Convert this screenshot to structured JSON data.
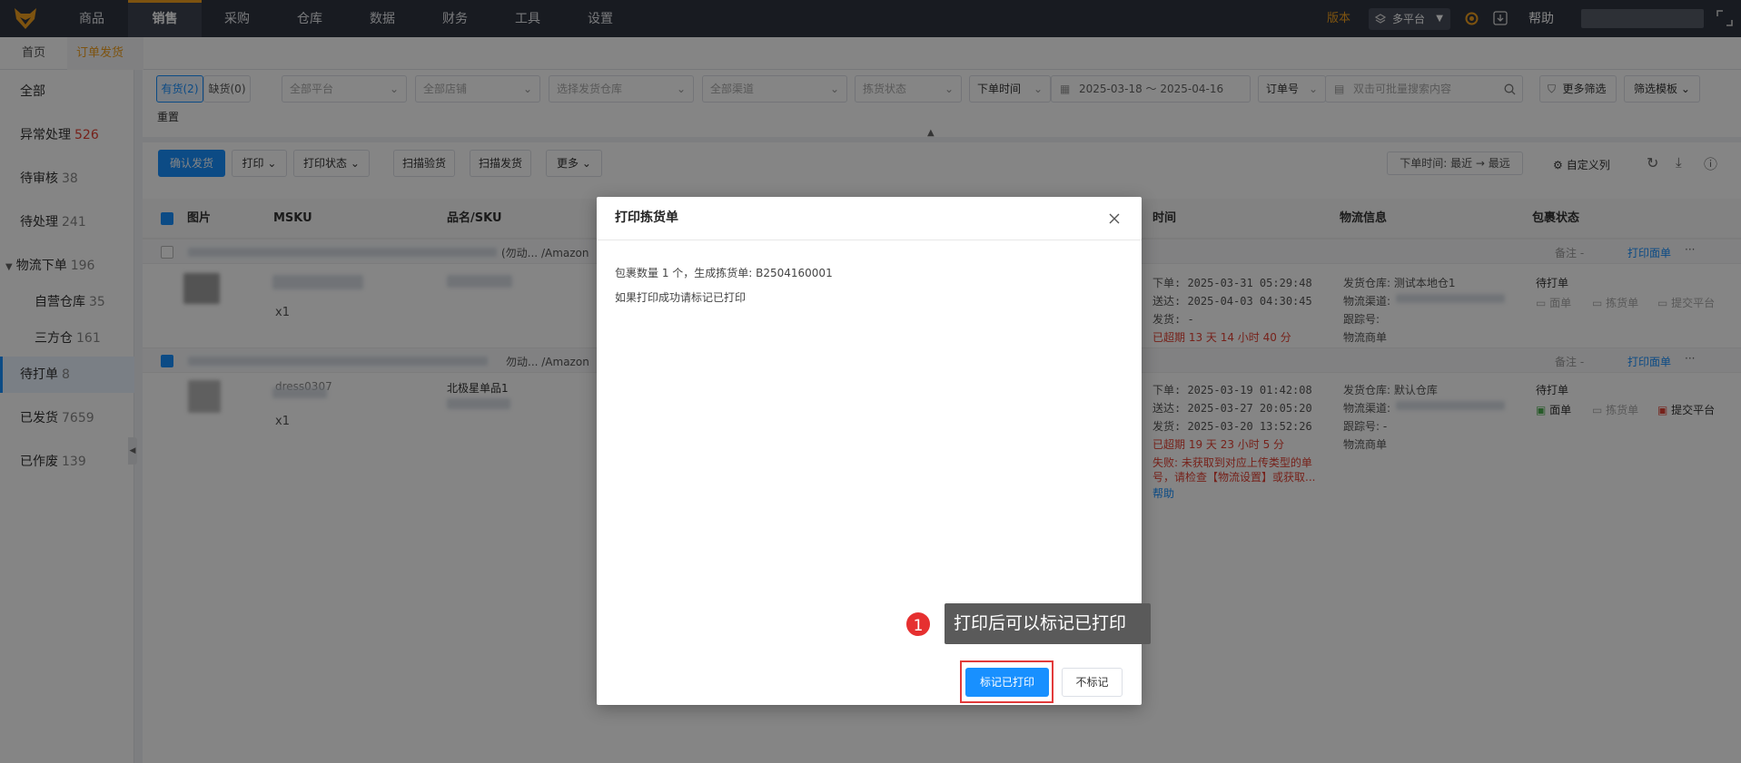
{
  "topnav": {
    "items": [
      "商品",
      "销售",
      "采购",
      "仓库",
      "数据",
      "财务",
      "工具",
      "设置"
    ],
    "active_index": 1,
    "version": "版本",
    "platform": "多平台",
    "help": "帮助"
  },
  "tabs": [
    "首页",
    "订单发货"
  ],
  "sidebar": [
    {
      "label": "全部",
      "count": ""
    },
    {
      "label": "异常处理",
      "count": "526"
    },
    {
      "label": "待审核",
      "count": "38"
    },
    {
      "label": "待处理",
      "count": "241"
    },
    {
      "label": "物流下单",
      "count": "196"
    },
    {
      "label": "自营仓库",
      "count": "35"
    },
    {
      "label": "三方仓",
      "count": "161"
    },
    {
      "label": "待打单",
      "count": "8"
    },
    {
      "label": "已发货",
      "count": "7659"
    },
    {
      "label": "已作废",
      "count": "139"
    }
  ],
  "filters": {
    "stock_yes": "有货(2)",
    "stock_no": "缺货(0)",
    "platform": "全部平台",
    "store": "全部店铺",
    "warehouse": "选择发货仓库",
    "channel": "全部渠道",
    "pick_status": "拣货状态",
    "time_type": "下单时间",
    "date_range": "2025-03-18 ～ 2025-04-16",
    "order_no": "订单号",
    "search_placeholder": "双击可批量搜索内容",
    "more_filter": "更多筛选",
    "template": "筛选模板",
    "reset": "重置"
  },
  "toolbar": {
    "confirm": "确认发货",
    "print": "打印",
    "print_status": "打印状态",
    "scan_check": "扫描验货",
    "scan_ship": "扫描发货",
    "more": "更多",
    "sort_label": "下单时间:",
    "sort_value": "最近 → 最远",
    "custom_cols": "自定义列"
  },
  "table": {
    "headers": [
      "图片",
      "MSKU",
      "品名/SKU",
      "时间",
      "物流信息",
      "包裹状态"
    ],
    "rows": [
      {
        "head_suffix": "(勿动... /Amazon",
        "remark": "备注 -",
        "print_label": "打印面单",
        "qty": "x1",
        "time_order": "下单: 2025-03-31 05:29:48",
        "time_deliver": "送达: 2025-04-03 04:30:45",
        "time_ship": "发货: -",
        "overdue": "已超期 13 天 14 小时 40 分",
        "ship_warehouse": "发货仓库: 测试本地仓1",
        "ship_channel": "物流渠道:",
        "tracking": "跟踪号:",
        "carrier_no": "物流商单",
        "status": "待打单",
        "act1": "面单",
        "act2": "拣货单",
        "act3": "提交平台"
      },
      {
        "head_suffix": "勿动... /Amazon",
        "remark": "备注 -",
        "print_label": "打印面单",
        "msku": "dress0307",
        "sku_name": "北极星单品1",
        "qty": "x1",
        "time_order": "下单: 2025-03-19 01:42:08",
        "time_deliver": "送达: 2025-03-27 20:05:20",
        "time_ship": "发货: 2025-03-20 13:52:26",
        "overdue": "已超期 19 天 23 小时 5 分",
        "fail_msg1": "失败: 未获取到对应上传类型的单",
        "fail_msg2": "号，请检查【物流设置】或获取...",
        "help": "帮助",
        "ship_warehouse": "发货仓库: 默认仓库",
        "ship_channel": "物流渠道:",
        "tracking": "跟踪号: -",
        "carrier_no": "物流商单",
        "status": "待打单",
        "act1": "面单",
        "act2": "拣货单",
        "act3": "提交平台"
      }
    ]
  },
  "dialog": {
    "title": "打印拣货单",
    "line1": "包裹数量 1 个，生成拣货单: B2504160001",
    "line2": "如果打印成功请标记已打印",
    "mark_btn": "标记已打印",
    "nomark_btn": "不标记"
  },
  "tip": {
    "badge": "1",
    "text": "打印后可以标记已打印"
  },
  "colors": {
    "accent": "#1890ff",
    "nav_bg": "#2f3440",
    "highlight": "#f0a020",
    "danger": "#e34234"
  }
}
